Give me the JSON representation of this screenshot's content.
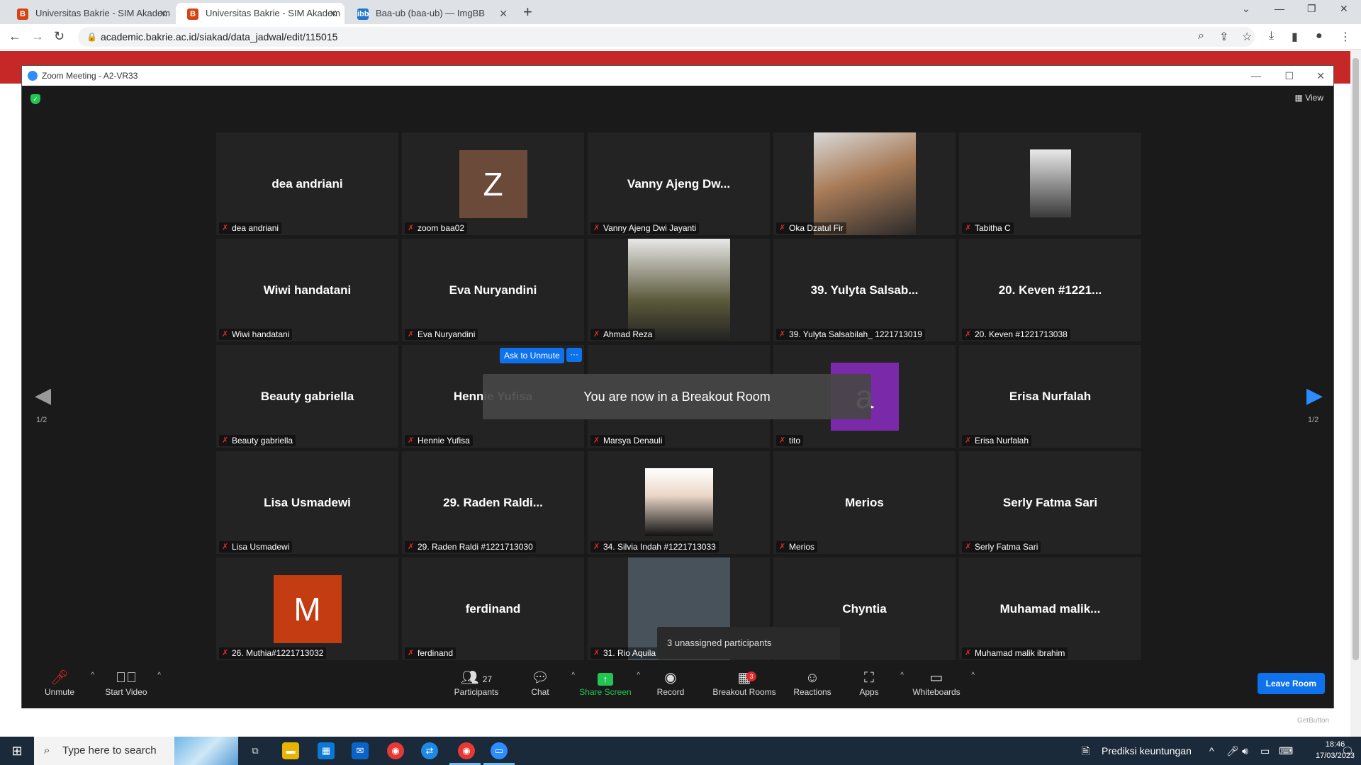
{
  "browser": {
    "tabs": [
      {
        "label": "Universitas Bakrie - SIM Akadem",
        "active": false,
        "favicon": "bakrie-b-icon"
      },
      {
        "label": "Universitas Bakrie - SIM Akadem",
        "active": true,
        "favicon": "bakrie-b-icon"
      },
      {
        "label": "Baa-ub (baa-ub) — ImgBB",
        "active": false,
        "favicon": "imgbb-icon"
      }
    ],
    "url": "academic.bakrie.ac.id/siakad/data_jadwal/edit/115015"
  },
  "zoom": {
    "window_title": "Zoom Meeting - A2-VR33",
    "view_label": "View",
    "page_indicator": "1/2",
    "toast": "You are now in a Breakout Room",
    "ask_unmute": "Ask to Unmute",
    "ask_more": "···",
    "unassigned": "3 unassigned participants",
    "tiles": [
      {
        "display": "dea andriani",
        "label": "dea andriani",
        "kind": "name"
      },
      {
        "display": "Z",
        "label": "zoom baa02",
        "kind": "avatar",
        "color": "#6b4a3a"
      },
      {
        "display": "Vanny Ajeng Dw...",
        "label": "Vanny Ajeng Dwi Jayanti",
        "kind": "name"
      },
      {
        "display": "",
        "label": "Oka Dzatul Fir",
        "kind": "photo",
        "photo": "man-sunglasses"
      },
      {
        "display": "",
        "label": "Tabitha C",
        "kind": "photo",
        "photo": "woman-portrait"
      },
      {
        "display": "Wiwi handatani",
        "label": "Wiwi handatani",
        "kind": "name"
      },
      {
        "display": "Eva Nuryandini",
        "label": "Eva Nuryandini",
        "kind": "name"
      },
      {
        "display": "",
        "label": "Ahmad Reza",
        "kind": "photo",
        "photo": "man-jacket"
      },
      {
        "display": "39. Yulyta Salsab...",
        "label": "39. Yulyta Salsabilah_ 1221713019",
        "kind": "name"
      },
      {
        "display": "20. Keven #1221...",
        "label": "20. Keven #1221713038",
        "kind": "name"
      },
      {
        "display": "Beauty gabriella",
        "label": "Beauty gabriella",
        "kind": "name"
      },
      {
        "display": "Hennie Yufisa",
        "label": "Hennie Yufisa",
        "kind": "name"
      },
      {
        "display": "",
        "label": "Marsya Denauli",
        "kind": "name"
      },
      {
        "display": "a",
        "label": "tito",
        "kind": "avatar",
        "color": "#7a2aa8"
      },
      {
        "display": "Erisa Nurfalah",
        "label": "Erisa Nurfalah",
        "kind": "name"
      },
      {
        "display": "Lisa Usmadewi",
        "label": "Lisa Usmadewi",
        "kind": "name"
      },
      {
        "display": "29. Raden Raldi...",
        "label": "29. Raden Raldi #1221713030",
        "kind": "name"
      },
      {
        "display": "",
        "label": "34. Silvia Indah #1221713033",
        "kind": "photo",
        "photo": "woman-hijab"
      },
      {
        "display": "Merios",
        "label": "Merios",
        "kind": "name"
      },
      {
        "display": "Serly Fatma Sari",
        "label": "Serly Fatma Sari",
        "kind": "name"
      },
      {
        "display": "M",
        "label": "26. Muthia#1221713032",
        "kind": "avatar",
        "color": "#c43c12"
      },
      {
        "display": "ferdinand",
        "label": "ferdinand",
        "kind": "name"
      },
      {
        "display": "",
        "label": "31. Rio Aquila",
        "kind": "photo",
        "photo": "slate-block"
      },
      {
        "display": "Chyntia",
        "label": "",
        "kind": "name"
      },
      {
        "display": "Muhamad  malik...",
        "label": "Muhamad malik ibrahim",
        "kind": "name"
      }
    ],
    "toolbar": {
      "unmute": "Unmute",
      "start_video": "Start Video",
      "participants": "Participants",
      "participants_count": "27",
      "chat": "Chat",
      "share_screen": "Share Screen",
      "record": "Record",
      "breakout_rooms": "Breakout Rooms",
      "breakout_badge": "3",
      "reactions": "Reactions",
      "apps": "Apps",
      "whiteboards": "Whiteboards",
      "leave_room": "Leave Room"
    },
    "getbutton": "GetButton"
  },
  "taskbar": {
    "search_placeholder": "Type here to search",
    "notification_app": "Prediksi keuntungan",
    "time": "18:46",
    "date": "17/03/2023"
  },
  "colors": {
    "accent": "#0e72ed",
    "share_green": "#23c552",
    "muted_red": "#e02828"
  }
}
